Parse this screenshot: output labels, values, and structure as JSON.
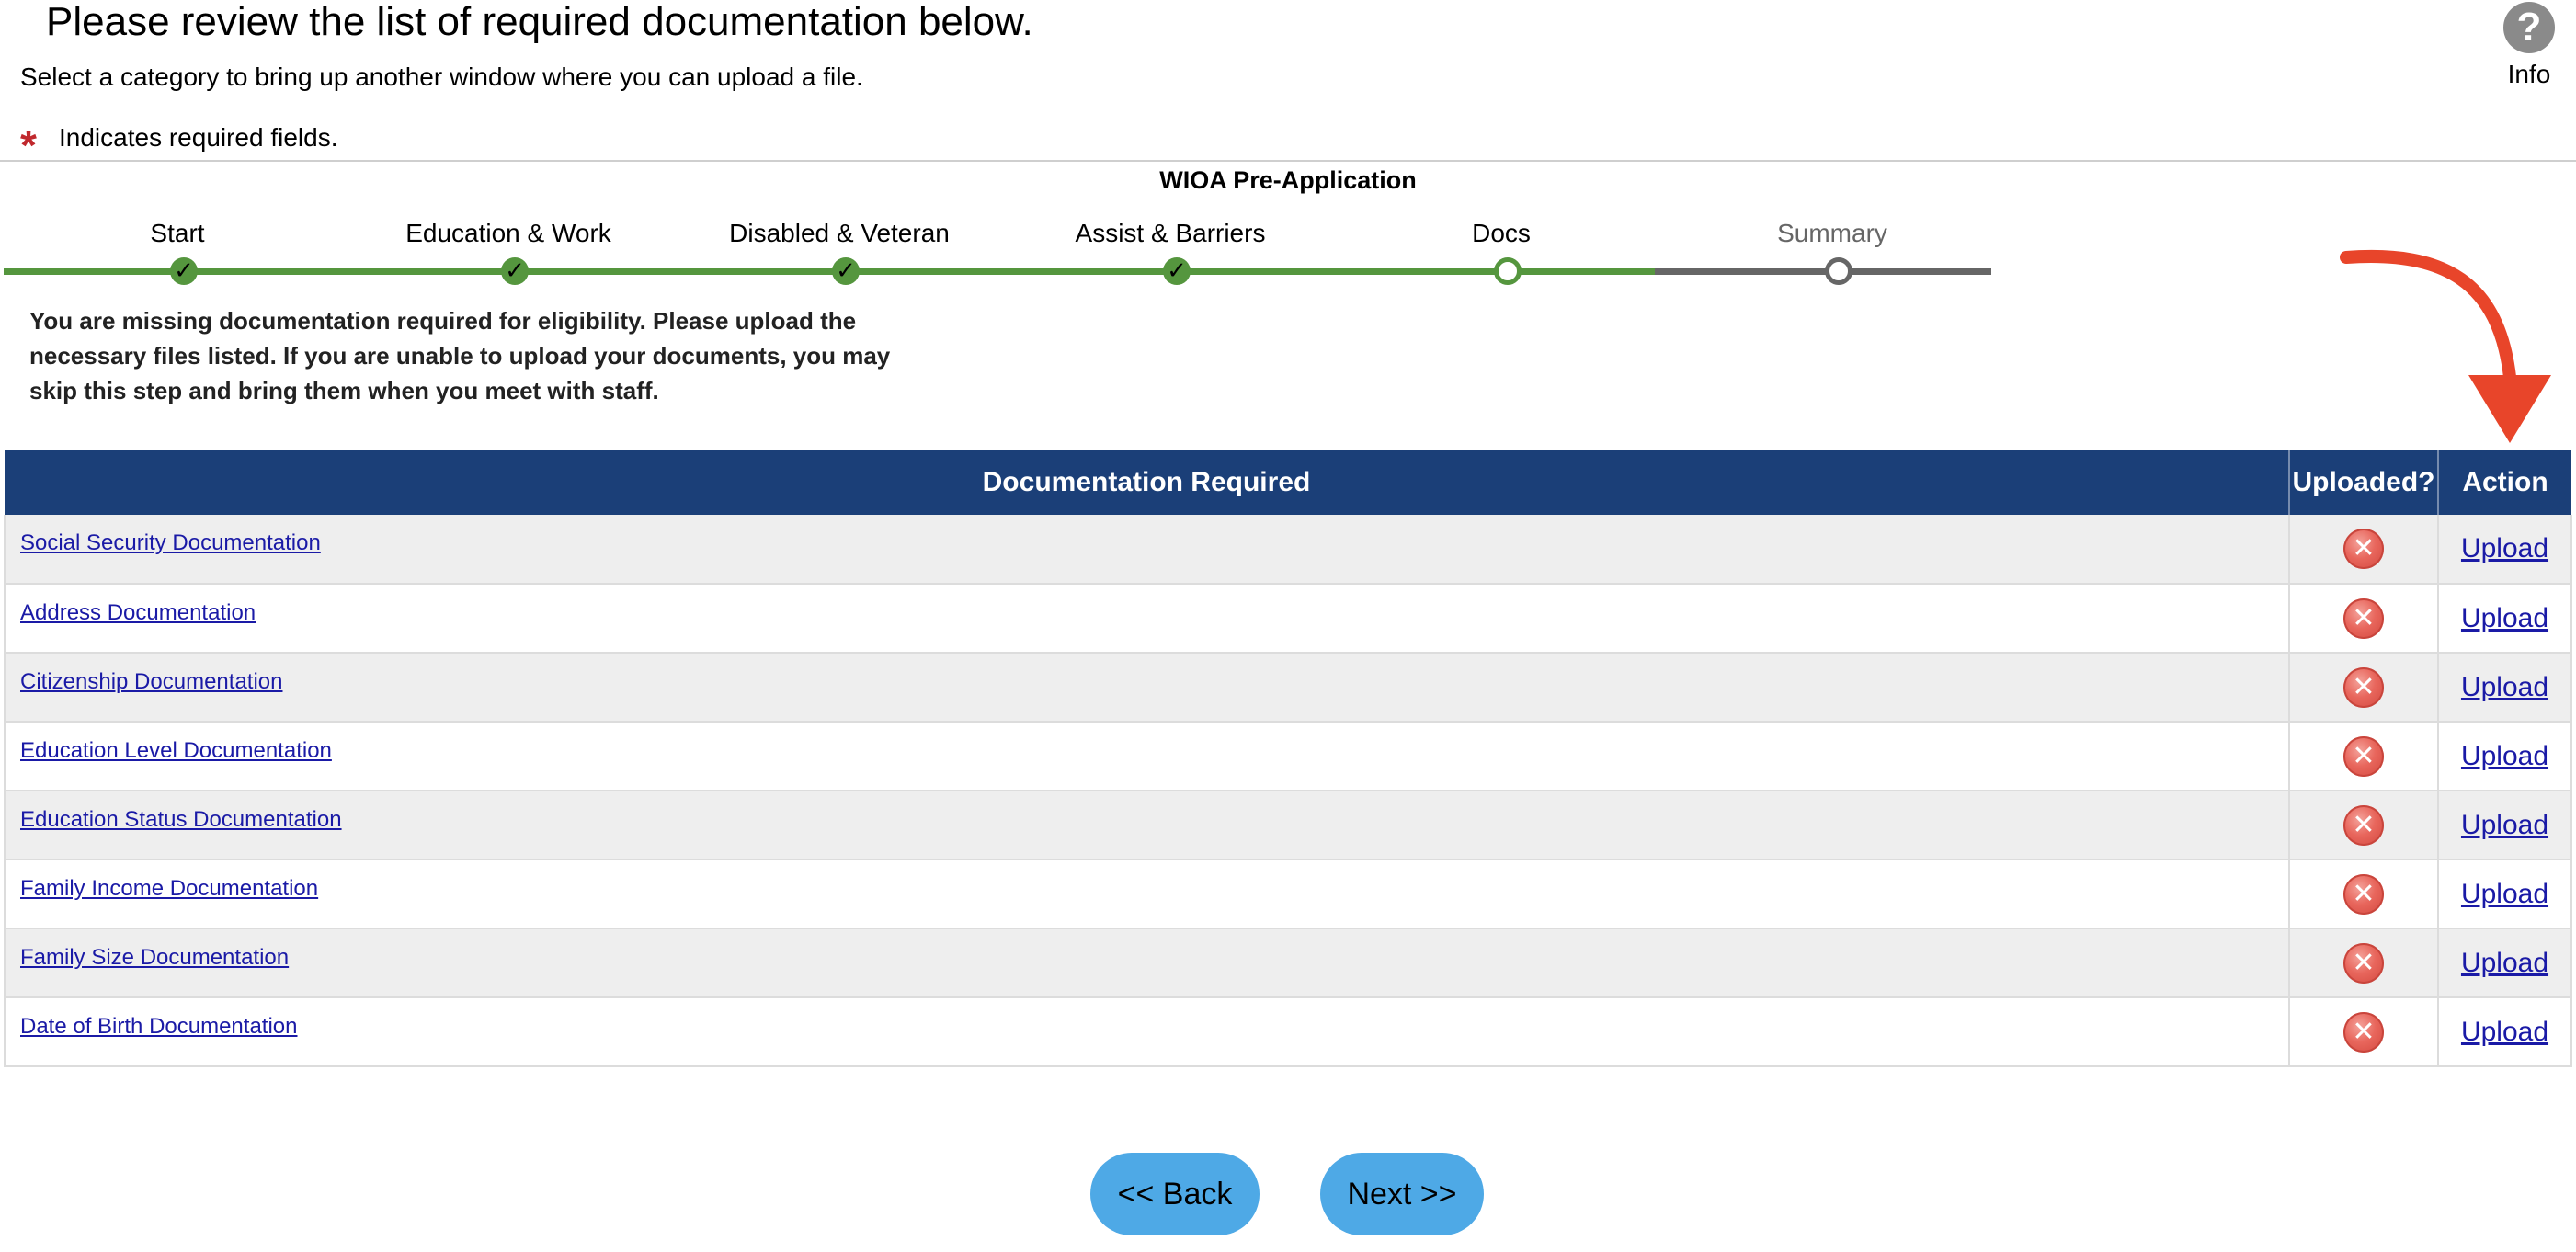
{
  "header": {
    "title": "Please review the list of required documentation below.",
    "subtitle": "Select a category to bring up another window where you can upload a file.",
    "required_star": "*",
    "required_note": "Indicates required fields."
  },
  "info": {
    "icon": "?",
    "label": "Info"
  },
  "progress": {
    "title": "WIOA Pre-Application",
    "steps": [
      {
        "label": "Start",
        "status": "done"
      },
      {
        "label": "Education & Work",
        "status": "done"
      },
      {
        "label": "Disabled & Veteran",
        "status": "done"
      },
      {
        "label": "Assist & Barriers",
        "status": "done"
      },
      {
        "label": "Docs",
        "status": "current"
      },
      {
        "label": "Summary",
        "status": "future"
      }
    ],
    "colors": {
      "done": "#55963e",
      "future": "#666666"
    }
  },
  "message": "You are missing documentation required for eligibility. Please upload the necessary files listed. If you are unable to upload your documents, you may skip this step and bring them when you meet with staff.",
  "table": {
    "headers": [
      "Documentation Required",
      "Uploaded?",
      "Action"
    ],
    "header_color": "#1b3f78",
    "rows": [
      {
        "name": "Social Security Documentation",
        "uploaded": "✕",
        "action": "Upload"
      },
      {
        "name": "Address Documentation",
        "uploaded": "✕",
        "action": "Upload"
      },
      {
        "name": "Citizenship Documentation",
        "uploaded": "✕",
        "action": "Upload"
      },
      {
        "name": "Education Level Documentation",
        "uploaded": "✕",
        "action": "Upload"
      },
      {
        "name": "Education Status Documentation",
        "uploaded": "✕",
        "action": "Upload"
      },
      {
        "name": "Family Income Documentation",
        "uploaded": "✕",
        "action": "Upload"
      },
      {
        "name": "Family Size Documentation",
        "uploaded": "✕",
        "action": "Upload"
      },
      {
        "name": "Date of Birth Documentation",
        "uploaded": "✕",
        "action": "Upload"
      }
    ]
  },
  "annotation": {
    "icon": "red-curved-arrow-icon",
    "color": "#e8452a"
  },
  "buttons": {
    "back": "<< Back",
    "next": "Next >>",
    "color": "#4ea9e6"
  }
}
